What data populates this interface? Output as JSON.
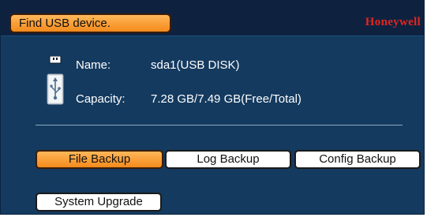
{
  "status": {
    "message": "Find USB device."
  },
  "brand": {
    "name": "Honeywell"
  },
  "device": {
    "name_label": "Name:",
    "name_value": "sda1(USB DISK)",
    "capacity_label": "Capacity:",
    "capacity_value": "7.28 GB/7.49 GB(Free/Total)"
  },
  "buttons": {
    "file_backup": "File Backup",
    "log_backup": "Log Backup",
    "config_backup": "Config Backup",
    "system_upgrade": "System Upgrade"
  },
  "selected_button": "file_backup",
  "colors": {
    "panel_background": "#143a5f",
    "title_bar_background": "#0e2240",
    "accent_orange": "#f48a1c",
    "brand_red": "#e3251d"
  },
  "icons": {
    "device": "usb-drive-icon"
  }
}
